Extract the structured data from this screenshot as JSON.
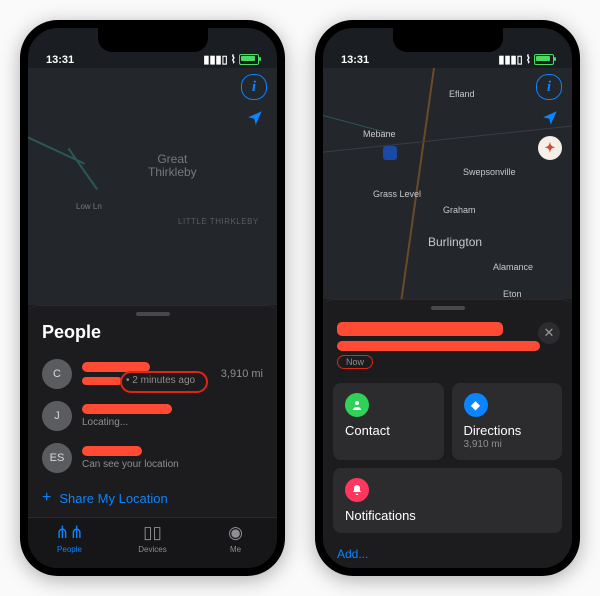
{
  "status": {
    "time": "13:31"
  },
  "phone1": {
    "map": {
      "primary_label": "Great\nThirkleby",
      "secondary_label": "LITTLE THIRKLEBY",
      "road_label": "Low Ln"
    },
    "sheet_title": "People",
    "people": [
      {
        "initial": "C",
        "timestamp": "2 minutes ago",
        "distance": "3,910 mi"
      },
      {
        "initial": "J",
        "status": "Locating..."
      },
      {
        "initial": "ES",
        "status": "Can see your location"
      }
    ],
    "share_label": "Share My Location",
    "tabs": [
      {
        "label": "People",
        "active": true
      },
      {
        "label": "Devices",
        "active": false
      },
      {
        "label": "Me",
        "active": false
      }
    ]
  },
  "phone2": {
    "map": {
      "labels": [
        "Efland",
        "Mebane",
        "Swepsonville",
        "Grass Level",
        "Graham",
        "Burlington",
        "Alamance",
        "Eton"
      ]
    },
    "detail": {
      "now_label": "Now",
      "contact_label": "Contact",
      "directions_label": "Directions",
      "directions_sub": "3,910 mi",
      "notifications_label": "Notifications",
      "add_label": "Add..."
    }
  }
}
